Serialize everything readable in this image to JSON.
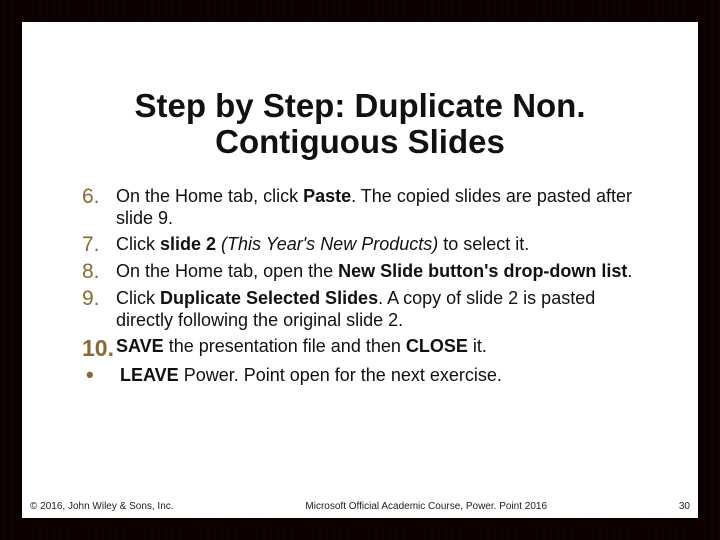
{
  "title": "Step by Step: Duplicate Non. Contiguous Slides",
  "items": [
    {
      "marker": "6.",
      "markerClass": "num",
      "html": "On the Home tab, click <b>Paste</b>. The copied slides are pasted after slide 9."
    },
    {
      "marker": "7.",
      "markerClass": "num",
      "html": "Click <b>slide 2</b> <i>(This Year's New Products)</i> to select it."
    },
    {
      "marker": "8.",
      "markerClass": "num",
      "html": "On the Home tab, open the <b>New Slide button's drop-down list</b>."
    },
    {
      "marker": "9.",
      "markerClass": "num",
      "html": "Click <b>Duplicate Selected Slides</b>. A copy of slide 2 is pasted directly following the original slide 2."
    },
    {
      "marker": "10.",
      "markerClass": "num10",
      "html": "<b>SAVE</b> the presentation file and then <b>CLOSE</b> it."
    },
    {
      "marker": "•",
      "markerClass": "bul",
      "html": "<b>LEAVE</b> Power. Point open for the next exercise."
    }
  ],
  "footer": {
    "copyright": "© 2016, John Wiley & Sons, Inc.",
    "course": "Microsoft Official Academic Course, Power. Point 2016",
    "page": "30"
  }
}
